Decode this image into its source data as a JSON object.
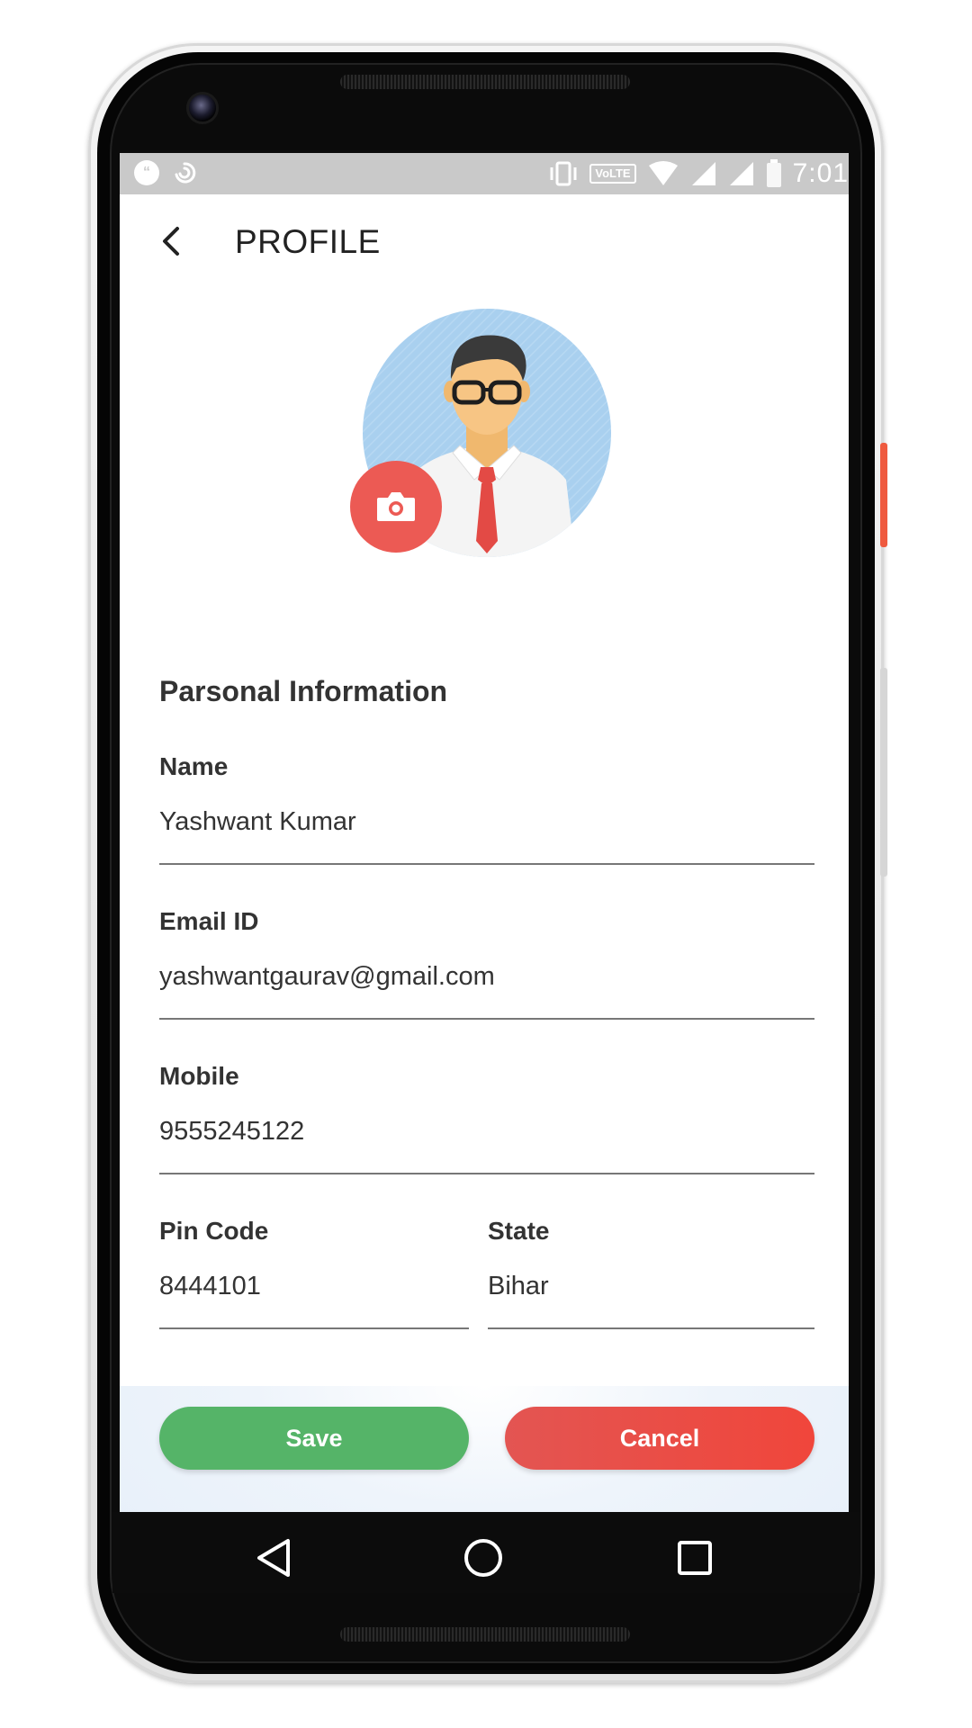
{
  "status_bar": {
    "time": "7:01",
    "volte_label": "VoLTE",
    "icons": [
      "hangouts-icon",
      "swirl-icon",
      "vibrate-icon",
      "volte-icon",
      "wifi-icon",
      "signal-icon",
      "signal-icon",
      "battery-icon"
    ]
  },
  "header": {
    "back_icon": "chevron-left-icon",
    "title": "PROFILE"
  },
  "avatar": {
    "camera_icon": "camera-icon",
    "accent_color": "#ec5a54",
    "background_color": "#a9d0ef"
  },
  "form": {
    "section_title": "Parsonal Information",
    "name": {
      "label": "Name",
      "value": "Yashwant Kumar"
    },
    "email": {
      "label": "Email ID",
      "value": "yashwantgaurav@gmail.com"
    },
    "mobile": {
      "label": "Mobile",
      "value": "9555245122"
    },
    "pin_code": {
      "label": "Pin Code",
      "value": "8444101"
    },
    "state": {
      "label": "State",
      "value": "Bihar"
    }
  },
  "actions": {
    "save_label": "Save",
    "cancel_label": "Cancel",
    "save_color": "#55b468",
    "cancel_color": "#ec4c47"
  },
  "nav_bar": {
    "icons": [
      "back-triangle-icon",
      "home-circle-icon",
      "recents-square-icon"
    ]
  }
}
